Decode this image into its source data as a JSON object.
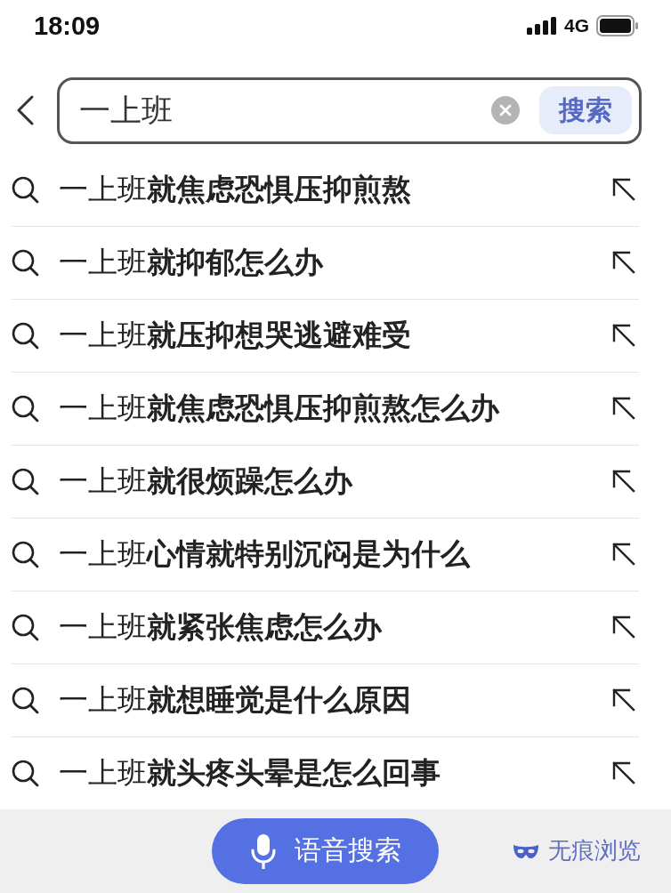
{
  "status_bar": {
    "time": "18:09",
    "network": "4G"
  },
  "search_bar": {
    "value": "一上班",
    "button": "搜索"
  },
  "suggestions": [
    {
      "text": "一上班**就焦虑恐惧压抑煎熬**"
    },
    {
      "text": "一上班**就抑郁怎么办**"
    },
    {
      "text": "一上班**就压抑想哭逃避难受**"
    },
    {
      "text": "一上班**就焦虑恐惧压抑煎熬怎么办**"
    },
    {
      "text": "一上班**就很烦躁怎么办**"
    },
    {
      "text": "一上班**心情就特别沉闷是为什么**"
    },
    {
      "text": "一上班**就紧张焦虑怎么办**"
    },
    {
      "text": "一上班**就想睡觉是什么原因**"
    },
    {
      "text": "一上班**就头疼头晕是怎么回事**"
    }
  ],
  "bottom_bar": {
    "voice_button": "语音搜索",
    "incognito": "无痕浏览"
  }
}
